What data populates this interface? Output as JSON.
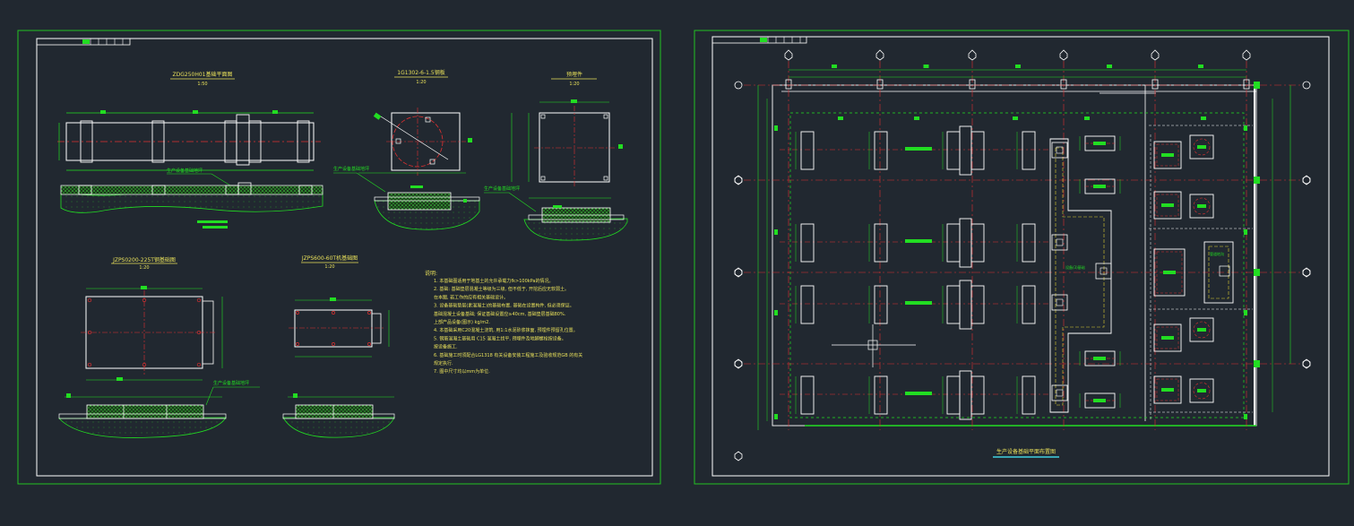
{
  "colors": {
    "background": "#212830",
    "border": "#22c222",
    "line": "#ffffff",
    "axis": "#e03030",
    "dim": "#22dd22",
    "title": "#e8e05a",
    "hatch": "#34d034",
    "yellow": "#e0d030",
    "cyan": "#40d0e0"
  },
  "sheet1": {
    "view_a_title": "ZDG250H01基础平面图",
    "view_a_scale": "1:50",
    "view_b_title": "1G1302-6-1.5钢板",
    "view_b_scale": "1:20",
    "view_c_title": "预埋件",
    "view_c_scale": "1:20",
    "view_d_title": "JZPS0200-225T钢基础图",
    "view_d_scale": "1:20",
    "view_e_title": "JZPS600-60T机基础图",
    "view_e_scale": "1:20",
    "leader_label": "生产设备基础地坪",
    "notes_heading": "说明:",
    "notes": [
      "1. 本基础图适用于地基土的允许承载力fk>100kPa的情况。",
      "2. 基础: 基础垫层混凝土等级为三级, 但不低于, 开挖后应无软弱土。",
      "   在本图, 若工作的应有相关基础设计。",
      "3. 设备基础垫层(素混凝土)的基础布置, 基础在设置构件, 但必须保证。",
      "   基础混凝土设备基础; 保证基础设置应≥40cm, 基础垫层基础80%.",
      "   上部产品设备(图示) kg/m2.",
      "4. 本基础采用C20混凝土浇筑, 用1:1水泥砂浆抹面, 预埋件预留孔位置。",
      "5. 钢筋混凝土基础用 C15 混凝土找平, 预埋件及地脚螺栓按设备。",
      "   按设备施工.",
      "6. 基础施工时须配合LG1318 有关设备安装工程施工及验收规范GB 的有关",
      "   规定执行.",
      "7. 图中尺寸均以mm为单位."
    ]
  },
  "sheet2": {
    "plan_title": "生产设备基础平面布置图",
    "label_a": "设备(3)基础",
    "label_b": "管道地沟"
  }
}
